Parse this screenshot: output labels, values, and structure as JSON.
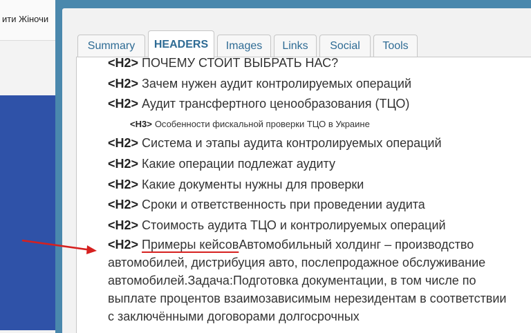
{
  "background_page": {
    "nav_text": "ити Жіночи"
  },
  "tabs": [
    {
      "label": "Summary"
    },
    {
      "label": "HEADERS"
    },
    {
      "label": "Images"
    },
    {
      "label": "Links"
    },
    {
      "label": "Social"
    },
    {
      "label": "Tools"
    }
  ],
  "headers": [
    {
      "tag": "<H2>",
      "text": "ПОЧЕМУ СТОИТ ВЫБРАТЬ НАС?"
    },
    {
      "tag": "<H2>",
      "text": "Зачем нужен аудит контролируемых операций"
    },
    {
      "tag": "<H2>",
      "text": "Аудит трансфертного ценообразования (ТЦО)"
    },
    {
      "tag": "<H3>",
      "text": "Особенности фискальной проверки ТЦО в Украине"
    },
    {
      "tag": "<H2>",
      "text": "Система и этапы аудита контролируемых операций"
    },
    {
      "tag": "<H2>",
      "text": "Какие операции подлежат аудиту"
    },
    {
      "tag": "<H2>",
      "text": "Какие документы нужны для проверки"
    },
    {
      "tag": "<H2>",
      "text": "Сроки и ответственность при проведении аудита"
    },
    {
      "tag": "<H2>",
      "text": "Стоимость аудита ТЦО и контролируемых операций"
    }
  ],
  "long_header": {
    "tag": "<H2>",
    "highlight": "Примеры кейсов",
    "text": "Автомобильный холдинг – производство автомобилей, дистрибуция авто, послепродажное обслуживание автомобилей.Задача:Подготовка документации, в том числе по выплате процентов взаимозависимым нерезидентам в соответствии с заключёнными договорами долгосрочных"
  },
  "colors": {
    "popup_frame": "#4a88ad",
    "tab_text": "#2e6b94",
    "annotation": "#d6201f",
    "bg_blue": "#2f52a8"
  }
}
